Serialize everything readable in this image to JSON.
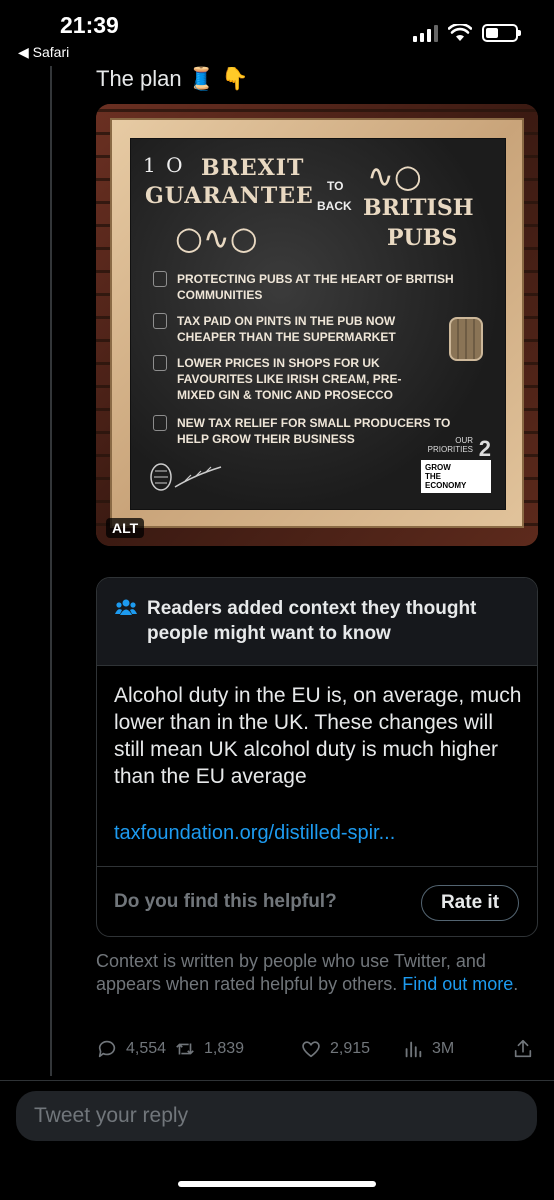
{
  "status_bar": {
    "time": "21:39",
    "back_app": "◀ Safari",
    "icons": [
      "cellular-signal-icon",
      "wifi-icon",
      "battery-icon"
    ]
  },
  "tweet": {
    "text": "The plan 🧵 👇",
    "image": {
      "alt_badge": "ALT",
      "board": {
        "number": "1 O",
        "title_line1": "BREXIT",
        "title_line2": "GUARANTEE",
        "to": "TO",
        "back": "BACK",
        "british": "BRITISH",
        "pubs": "PUBS",
        "bullets": [
          "PROTECTING PUBS AT THE HEART OF BRITISH COMMUNITIES",
          "TAX PAID ON PINTS IN THE PUB NOW CHEAPER THAN THE SUPERMARKET",
          "LOWER PRICES IN SHOPS FOR UK FAVOURITES LIKE IRISH CREAM, PRE-MIXED GIN & TONIC AND PROSECCO",
          "NEW TAX RELIEF FOR SMALL PRODUCERS TO HELP GROW THEIR BUSINESS"
        ],
        "priorities_label_1": "OUR",
        "priorities_label_2": "PRIORITIES",
        "priorities_number": "2",
        "priorities_box_1": "GROW",
        "priorities_box_2": "THE",
        "priorities_box_3": "ECONOMY"
      }
    },
    "community_note": {
      "title": "Readers added context they thought people might want to know",
      "body": "Alcohol duty in the EU is, on average, much lower than in the UK. These changes will still mean UK alcohol duty is much higher than the EU average",
      "link": "taxfoundation.org/distilled-spir...",
      "helpful_question": "Do you find this helpful?",
      "rate_button": "Rate it"
    },
    "context_info": {
      "text": "Context is written by people who use Twitter, and appears when rated helpful by others.",
      "link": "Find out more",
      "period": "."
    },
    "actions": {
      "replies": "4,554",
      "retweets": "1,839",
      "likes": "2,915",
      "views": "3M"
    }
  },
  "reply": {
    "placeholder": "Tweet your reply"
  },
  "colors": {
    "background": "#000000",
    "text": "#e7e9ea",
    "muted": "#71767b",
    "link": "#1d9bf0",
    "note_header": "#16181c"
  }
}
